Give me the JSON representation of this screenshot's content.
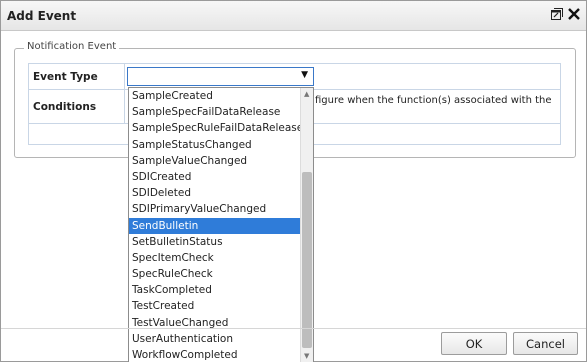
{
  "dialog": {
    "title": "Add Event"
  },
  "fieldset": {
    "legend": "Notification Event"
  },
  "form": {
    "event_type_label": "Event Type",
    "conditions_label": "Conditions",
    "conditions_text": "figure when the function(s) associated with the"
  },
  "select": {
    "value": "",
    "arrow": "▼"
  },
  "dropdown": {
    "options": [
      "SampleCreated",
      "SampleSpecFailDataRelease",
      "SampleSpecRuleFailDataRelease",
      "SampleStatusChanged",
      "SampleValueChanged",
      "SDICreated",
      "SDIDeleted",
      "SDIPrimaryValueChanged",
      "SendBulletin",
      "SetBulletinStatus",
      "SpecItemCheck",
      "SpecRuleCheck",
      "TaskCompleted",
      "TestCreated",
      "TestValueChanged",
      "UserAuthentication",
      "WorkflowCompleted"
    ],
    "selected": "SendBulletin"
  },
  "buttons": {
    "ok": "OK",
    "cancel": "Cancel"
  },
  "colors": {
    "selection": "#2f7cd9",
    "select_border": "#3a78c8",
    "grid_border": "#c9d6e6"
  }
}
